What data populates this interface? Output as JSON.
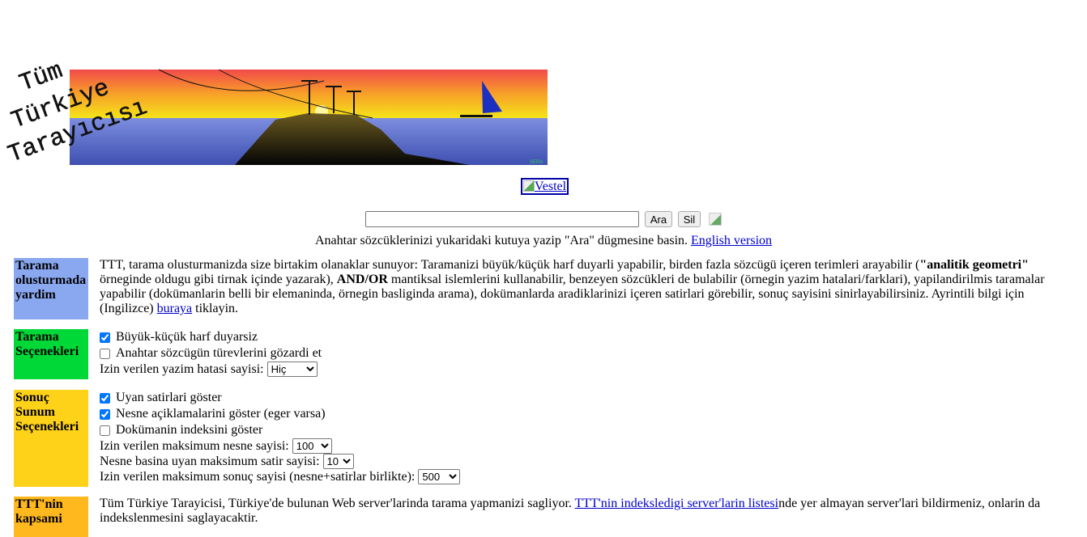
{
  "logo": {
    "text_lines": [
      "Tüm",
      "Türkiye",
      "Tarayıcısı"
    ],
    "signature": "SERA"
  },
  "sponsor": {
    "alt": "Vestel"
  },
  "search": {
    "value": "",
    "placeholder": "",
    "search_label": "Ara",
    "clear_label": "Sil"
  },
  "help": {
    "text": "Anahtar sözcüklerinizi yukaridaki kutuya yazip \"Ara\" dügmesine basin. ",
    "link": "English version"
  },
  "sections": [
    {
      "label": "Tarama olusturmada yardim",
      "color": "#8aa8f0",
      "text_a": "TTT, tarama olusturmanizda size birtakim olanaklar sunuyor: Taramanizi büyük/küçük harf duyarli yapabilir, birden fazla sözcügü içeren terimleri arayabilir (",
      "bold_a": "\"analitik geometri\"",
      "text_b": " örneginde oldugu gibi tirnak içinde yazarak), ",
      "bold_b": "AND/OR",
      "text_c": " mantiksal islemlerini kullanabilir, benzeyen sözcükleri de bulabilir (örnegin yazim hatalari/farklari), yapilandirilmis taramalar yapabilir (dokümanlarin belli bir elemaninda, örnegin basliginda arama), dokümanlarda aradiklarinizi içeren satirlari görebilir, sonuç sayisini sinirlayabilirsiniz. Ayrintili bilgi için (Ingilizce) ",
      "link": "buraya",
      "text_d": " tiklayin."
    },
    {
      "label": "Tarama Seçenekleri",
      "color": "#00d838",
      "checkboxes": [
        {
          "label": "Büyük-küçük harf duyarsiz",
          "checked": true
        },
        {
          "label": "Anahtar sözcügün türevlerini gözardi et",
          "checked": false
        }
      ],
      "typo_label": "Izin verilen yazim hatasi sayisi:",
      "typo_value": "Hiç"
    },
    {
      "label": "Sonuç Sunum Seçenekleri",
      "color": "#ffd21a",
      "checkboxes": [
        {
          "label": "Uyan satirlari göster",
          "checked": true
        },
        {
          "label": "Nesne açiklamalarini göster (eger varsa)",
          "checked": true
        },
        {
          "label": "Dokümanin indeksini göster",
          "checked": false
        }
      ],
      "max_objects_label": "Izin verilen maksimum nesne sayisi:",
      "max_objects_value": "100",
      "max_lines_label": "Nesne basina uyan maksimum satir sayisi:",
      "max_lines_value": "10",
      "max_results_label": "Izin verilen maksimum sonuç sayisi (nesne+satirlar birlikte):",
      "max_results_value": "500"
    },
    {
      "label": "TTT'nin kapsami",
      "color": "#ffb81e",
      "text_a": "Tüm Türkiye Tarayicisi, Türkiye'de bulunan Web server'larinda tarama yapmanizi sagliyor. ",
      "link": "TTT'nin indeksledigi server'larin listesi",
      "text_b": "nde yer almayan server'lari bildirmeniz, onlarin da indekslenmesini saglayacaktir."
    }
  ]
}
